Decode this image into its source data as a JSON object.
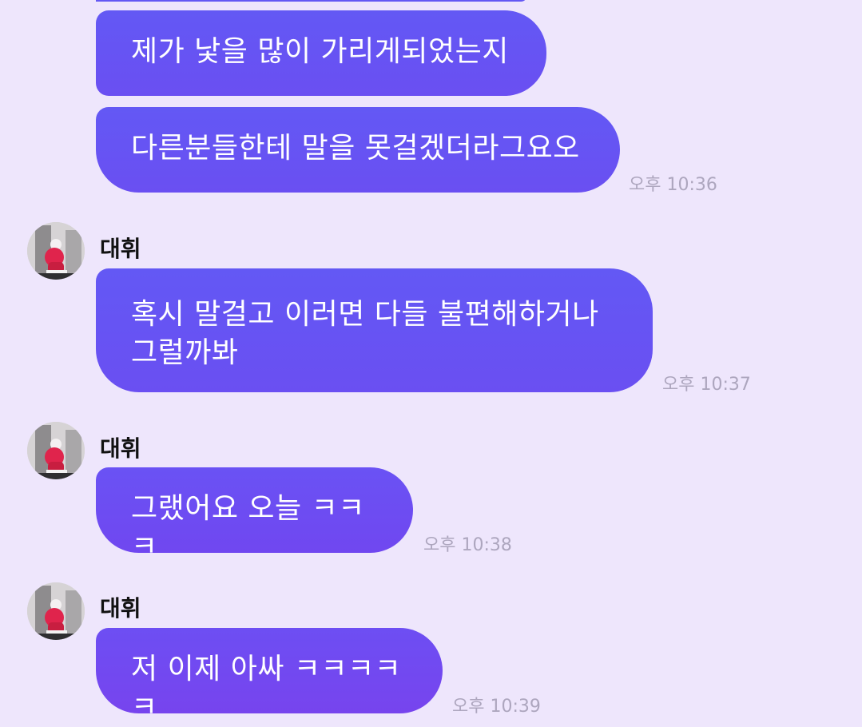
{
  "messages": [
    {
      "text": "제가 낯을 많이 가리게되었는지",
      "time": ""
    },
    {
      "text": "다른분들한테 말을 못걸겠더라그요오",
      "time": "오후 10:36"
    },
    {
      "sender": "대휘",
      "text": "혹시 말걸고 이러면 다들 불편해하거나\n그럴까봐",
      "time": "오후 10:37"
    },
    {
      "sender": "대휘",
      "text": "그랬어요 오늘 ㅋㅋㅋ",
      "time": "오후 10:38"
    },
    {
      "sender": "대휘",
      "text": "저 이제 아싸 ㅋㅋㅋㅋㅋ",
      "time": "오후 10:39"
    }
  ],
  "colors": {
    "background": "#EEE6FC",
    "bubble": "#6358F4",
    "timestamp": "#ADA6BE",
    "sender_name": "#111111"
  },
  "icons": {
    "avatar": "profile-photo"
  }
}
